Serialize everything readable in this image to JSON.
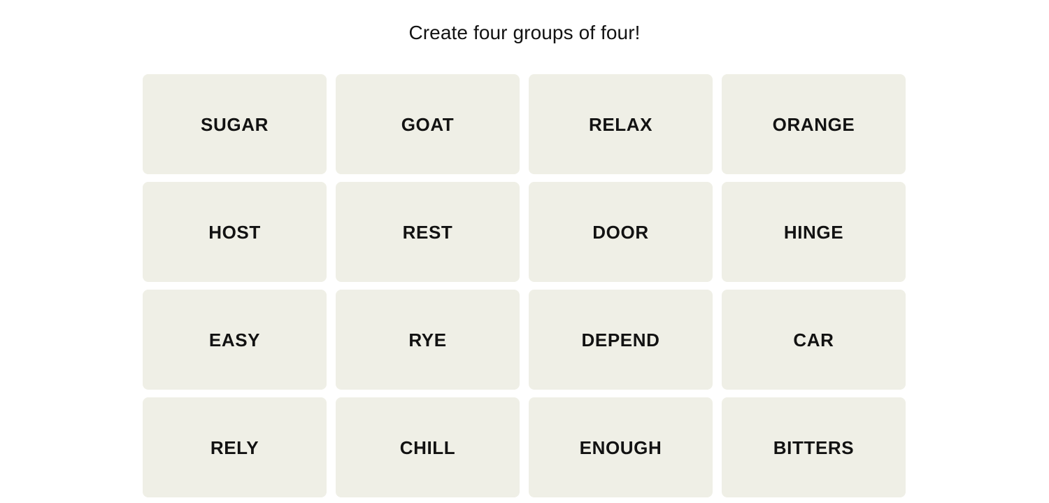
{
  "page": {
    "background_color": "#ffffff",
    "text_color": "#121212"
  },
  "header": {
    "title": "Create four groups of four!"
  },
  "board": {
    "tile_background_color": "#efefe6",
    "tile_text_color": "#121212",
    "rows": 4,
    "columns": 4,
    "tiles": [
      {
        "label": "SUGAR"
      },
      {
        "label": "GOAT"
      },
      {
        "label": "RELAX"
      },
      {
        "label": "ORANGE"
      },
      {
        "label": "HOST"
      },
      {
        "label": "REST"
      },
      {
        "label": "DOOR"
      },
      {
        "label": "HINGE"
      },
      {
        "label": "EASY"
      },
      {
        "label": "RYE"
      },
      {
        "label": "DEPEND"
      },
      {
        "label": "CAR"
      },
      {
        "label": "RELY"
      },
      {
        "label": "CHILL"
      },
      {
        "label": "ENOUGH"
      },
      {
        "label": "BITTERS"
      }
    ]
  }
}
